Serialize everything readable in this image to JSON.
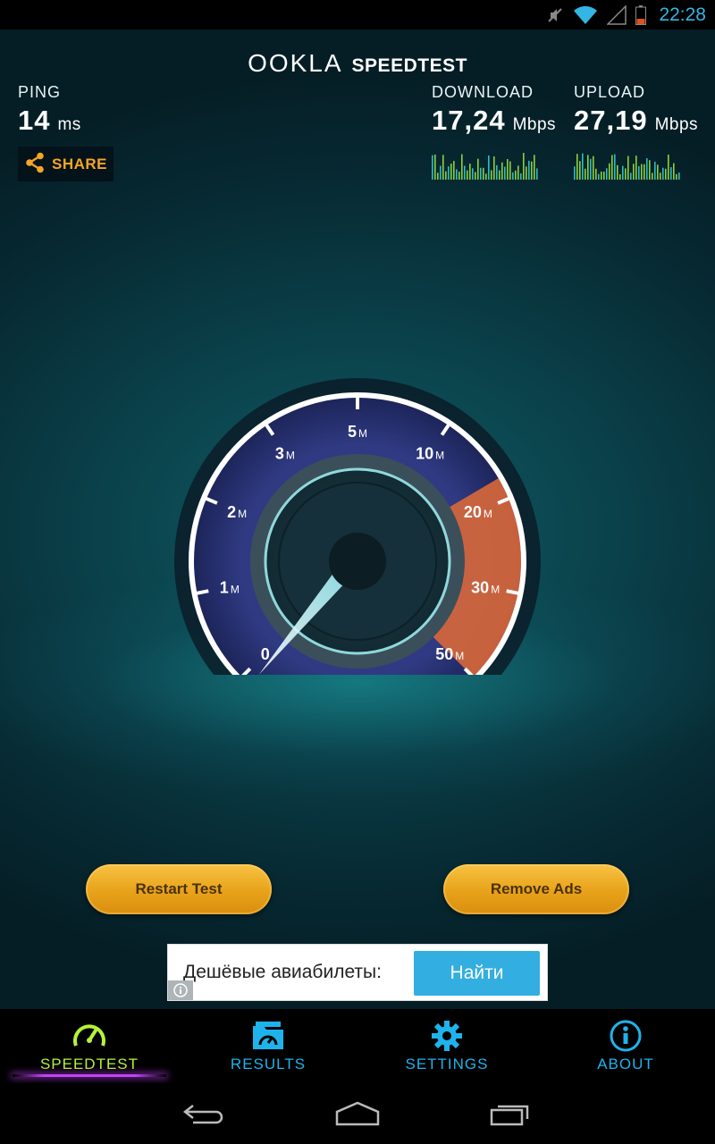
{
  "status_bar": {
    "time": "22:28",
    "icons": [
      "muted-icon",
      "wifi-icon",
      "signal-icon",
      "battery-icon"
    ]
  },
  "header": {
    "logo_ookla": "OOKLA",
    "logo_speedtest": "SPEEDTEST"
  },
  "metrics": {
    "ping": {
      "label": "PING",
      "value": "14",
      "unit": "ms"
    },
    "download": {
      "label": "DOWNLOAD",
      "value": "17,24",
      "unit": "Mbps"
    },
    "upload": {
      "label": "UPLOAD",
      "value": "27,19",
      "unit": "Mbps"
    }
  },
  "share": {
    "label": "SHARE",
    "icon": "share-icon"
  },
  "gauge": {
    "scale_labels": [
      "0",
      "1",
      "2",
      "3",
      "5",
      "10",
      "20",
      "30",
      "50"
    ],
    "unit_suffix": "M",
    "needle_value": 0
  },
  "buttons": {
    "restart": "Restart Test",
    "remove_ads": "Remove Ads"
  },
  "ad": {
    "text": "Дешёвые авиабилеты:",
    "button": "Найти",
    "info_icon": "info-icon"
  },
  "tabs": [
    {
      "label": "SPEEDTEST",
      "icon": "speedometer-icon",
      "active": true
    },
    {
      "label": "RESULTS",
      "icon": "results-folder-icon",
      "active": false
    },
    {
      "label": "SETTINGS",
      "icon": "gear-icon",
      "active": false
    },
    {
      "label": "ABOUT",
      "icon": "info-icon",
      "active": false
    }
  ],
  "nav": {
    "back": "back-icon",
    "home": "home-icon",
    "recents": "recents-icon"
  },
  "colors": {
    "accent_blue": "#33b5e5",
    "tab_blue": "#1fb3ec",
    "active_green": "#b5f33a",
    "share_orange": "#f5a623",
    "button_gold": "#e8a21a",
    "gauge_orange": "#e8783a"
  }
}
